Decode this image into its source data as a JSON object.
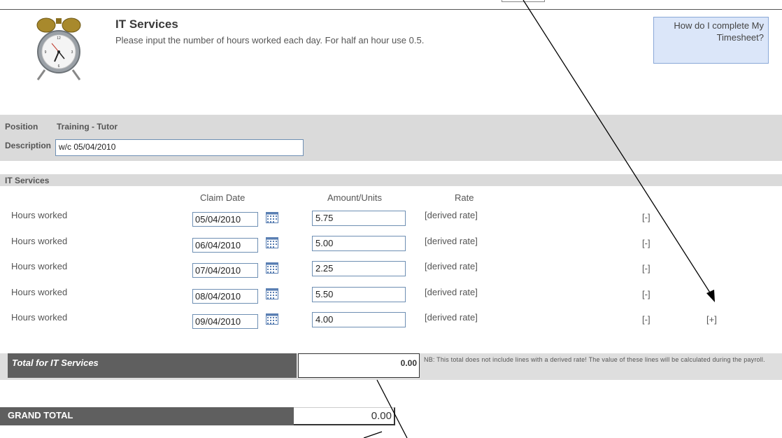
{
  "header": {
    "title": "IT Services",
    "instructions": "Please input the number of hours worked each day. For half an hour use 0.5.",
    "help_link": "How do I complete My Timesheet?"
  },
  "position_section": {
    "position_label": "Position",
    "position_value": "Training - Tutor",
    "description_label": "Description",
    "description_value": "w/c 05/04/2010"
  },
  "section": {
    "title": "IT Services",
    "col_claim_date": "Claim Date",
    "col_amount": "Amount/Units",
    "col_rate": "Rate",
    "rows": [
      {
        "label": "Hours worked",
        "date": "05/04/2010",
        "amount": "5.75",
        "rate": "[derived rate]",
        "remove": "[-]"
      },
      {
        "label": "Hours worked",
        "date": "06/04/2010",
        "amount": "5.00",
        "rate": "[derived rate]",
        "remove": "[-]"
      },
      {
        "label": "Hours worked",
        "date": "07/04/2010",
        "amount": "2.25",
        "rate": "[derived rate]",
        "remove": "[-]"
      },
      {
        "label": "Hours worked",
        "date": "08/04/2010",
        "amount": "5.50",
        "rate": "[derived rate]",
        "remove": "[-]"
      },
      {
        "label": "Hours worked",
        "date": "09/04/2010",
        "amount": "4.00",
        "rate": "[derived rate]",
        "remove": "[-]"
      }
    ],
    "add_label": "[+]"
  },
  "total": {
    "label": "Total for IT Services",
    "value": "0.00",
    "note": "NB: This total does not include lines with a derived rate! The value of these lines will be calculated during the payroll."
  },
  "grand_total": {
    "label": "GRAND TOTAL",
    "value": "0.00"
  },
  "icons": {
    "clock": "alarm-clock-icon",
    "calendar": "calendar-icon"
  }
}
